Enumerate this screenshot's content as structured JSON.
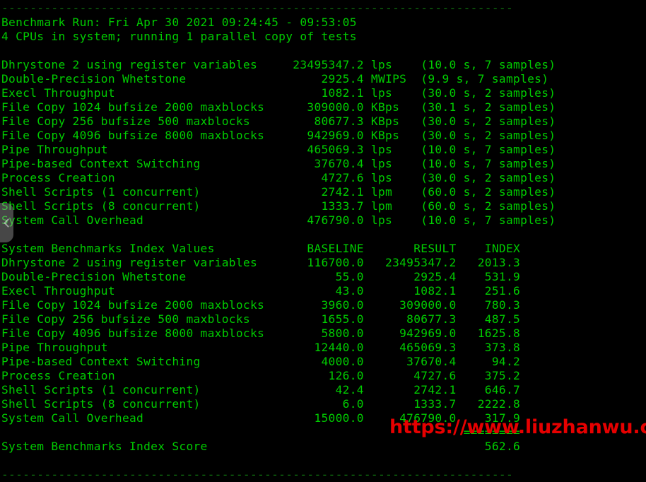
{
  "terminal": {
    "background_color": "#000000",
    "text_color": "#00cc00",
    "dim_rule_color": "#0f6b0f",
    "top_rule": "------------------------------------------------------------------------",
    "bottom_rule": "------------------------------------------------------------------------",
    "header": {
      "run_line": "Benchmark Run: Fri Apr 30 2021 09:24:45 - 09:53:05",
      "cpu_line": "4 CPUs in system; running 1 parallel copy of tests"
    },
    "results_block": {
      "rows": [
        {
          "label": "Dhrystone 2 using register variables",
          "value": "23495347.2",
          "unit": "lps",
          "timing": "(10.0 s, 7 samples)"
        },
        {
          "label": "Double-Precision Whetstone",
          "value": "2925.4",
          "unit": "MWIPS",
          "timing": "(9.9 s, 7 samples)"
        },
        {
          "label": "Execl Throughput",
          "value": "1082.1",
          "unit": "lps",
          "timing": "(30.0 s, 2 samples)"
        },
        {
          "label": "File Copy 1024 bufsize 2000 maxblocks",
          "value": "309000.0",
          "unit": "KBps",
          "timing": "(30.1 s, 2 samples)"
        },
        {
          "label": "File Copy 256 bufsize 500 maxblocks",
          "value": "80677.3",
          "unit": "KBps",
          "timing": "(30.0 s, 2 samples)"
        },
        {
          "label": "File Copy 4096 bufsize 8000 maxblocks",
          "value": "942969.0",
          "unit": "KBps",
          "timing": "(30.0 s, 2 samples)"
        },
        {
          "label": "Pipe Throughput",
          "value": "465069.3",
          "unit": "lps",
          "timing": "(10.0 s, 7 samples)"
        },
        {
          "label": "Pipe-based Context Switching",
          "value": "37670.4",
          "unit": "lps",
          "timing": "(10.0 s, 7 samples)"
        },
        {
          "label": "Process Creation",
          "value": "4727.6",
          "unit": "lps",
          "timing": "(30.0 s, 2 samples)"
        },
        {
          "label": "Shell Scripts (1 concurrent)",
          "value": "2742.1",
          "unit": "lpm",
          "timing": "(60.0 s, 2 samples)"
        },
        {
          "label": "Shell Scripts (8 concurrent)",
          "value": "1333.7",
          "unit": "lpm",
          "timing": "(60.0 s, 2 samples)"
        },
        {
          "label": "System Call Overhead",
          "value": "476790.0",
          "unit": "lps",
          "timing": "(10.0 s, 7 samples)"
        }
      ]
    },
    "index_block": {
      "title": "System Benchmarks Index Values",
      "columns": [
        "BASELINE",
        "RESULT",
        "INDEX"
      ],
      "rows": [
        {
          "label": "Dhrystone 2 using register variables",
          "baseline": "116700.0",
          "result": "23495347.2",
          "index": "2013.3"
        },
        {
          "label": "Double-Precision Whetstone",
          "baseline": "55.0",
          "result": "2925.4",
          "index": "531.9"
        },
        {
          "label": "Execl Throughput",
          "baseline": "43.0",
          "result": "1082.1",
          "index": "251.6"
        },
        {
          "label": "File Copy 1024 bufsize 2000 maxblocks",
          "baseline": "3960.0",
          "result": "309000.0",
          "index": "780.3"
        },
        {
          "label": "File Copy 256 bufsize 500 maxblocks",
          "baseline": "1655.0",
          "result": "80677.3",
          "index": "487.5"
        },
        {
          "label": "File Copy 4096 bufsize 8000 maxblocks",
          "baseline": "5800.0",
          "result": "942969.0",
          "index": "1625.8"
        },
        {
          "label": "Pipe Throughput",
          "baseline": "12440.0",
          "result": "465069.3",
          "index": "373.8"
        },
        {
          "label": "Pipe-based Context Switching",
          "baseline": "4000.0",
          "result": "37670.4",
          "index": "94.2"
        },
        {
          "label": "Process Creation",
          "baseline": "126.0",
          "result": "4727.6",
          "index": "375.2"
        },
        {
          "label": "Shell Scripts (1 concurrent)",
          "baseline": "42.4",
          "result": "2742.1",
          "index": "646.7"
        },
        {
          "label": "Shell Scripts (8 concurrent)",
          "baseline": "6.0",
          "result": "1333.7",
          "index": "2222.8"
        },
        {
          "label": "System Call Overhead",
          "baseline": "15000.0",
          "result": "476790.0",
          "index": "317.9"
        }
      ],
      "score_separator": "========",
      "score_label": "System Benchmarks Index Score",
      "score_value": "562.6"
    }
  },
  "watermark": {
    "text": "https://www.liuzhanwu.cn",
    "color": "#e60000"
  },
  "panel_handle": {
    "icon": "chevron-left-icon"
  }
}
